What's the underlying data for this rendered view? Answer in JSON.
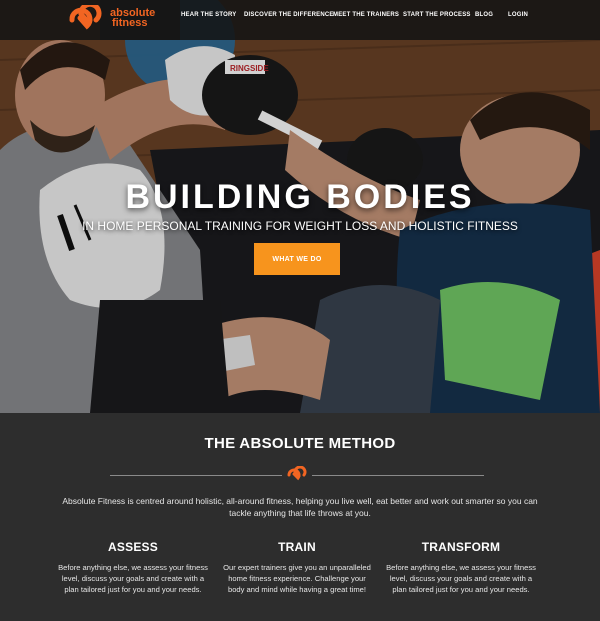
{
  "brand": {
    "name_line1": "absolute",
    "name_line2": "fitness",
    "accent": "#f26522",
    "logo_icon": "infinity-link-logo-icon"
  },
  "nav": {
    "items": [
      {
        "label": "HEAR THE STORY"
      },
      {
        "label": "DISCOVER THE DIFFERENCE"
      },
      {
        "label": "MEET THE TRAINERS"
      },
      {
        "label": "START THE PROCESS"
      },
      {
        "label": "BLOG"
      },
      {
        "label": "LOGIN"
      }
    ]
  },
  "hero": {
    "title": "BUILDING BODIES",
    "subtitle": "IN HOME PERSONAL TRAINING FOR WEIGHT LOSS AND HOLISTIC FITNESS",
    "button_label": "WHAT WE DO",
    "button_color": "#f7941d",
    "glove_text": "RINGSIDE"
  },
  "method": {
    "title": "THE ABSOLUTE METHOD",
    "intro": "Absolute Fitness is centred around holistic, all-around fitness, helping you live well, eat better and work out smarter so you can tackle anything that life throws at you.",
    "columns": [
      {
        "title": "ASSESS",
        "text": "Before anything else, we assess your fitness level, discuss your goals and create with a plan tailored just for you and your needs."
      },
      {
        "title": "TRAIN",
        "text": "Our expert trainers give you an unparalleled home fitness experience. Challenge your body and mind while having a great time!"
      },
      {
        "title": "TRANSFORM",
        "text": "Before anything else, we assess your fitness level, discuss your goals and create with a plan tailored just for you and your needs."
      }
    ]
  }
}
